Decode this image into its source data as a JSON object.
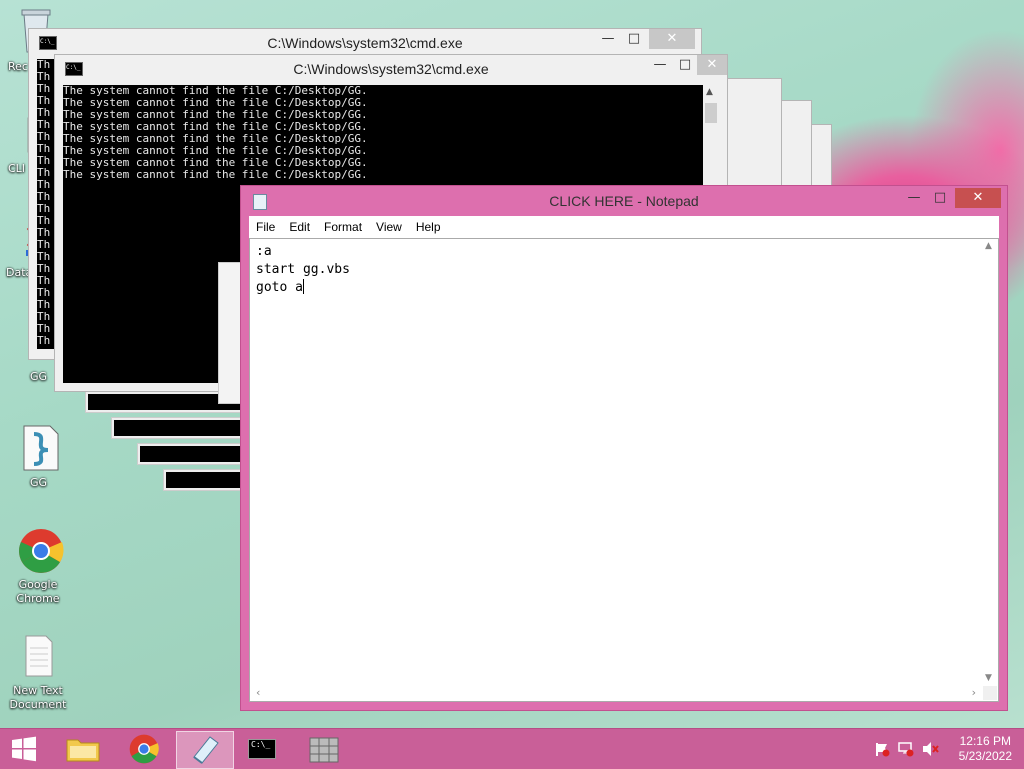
{
  "desktop": {
    "icons": [
      {
        "label": "Rec"
      },
      {
        "label": "CLI"
      },
      {
        "label": "Data"
      },
      {
        "label": "GG"
      },
      {
        "label": "GG"
      },
      {
        "label": "Google Chrome"
      },
      {
        "label": "New Text Document"
      }
    ]
  },
  "cmd_windows": {
    "title": "C:\\Windows\\system32\\cmd.exe",
    "icon_text": "C:\\_",
    "error_line": "The system cannot find the file C:/Desktop/GG.",
    "truncated_prefix": "Th"
  },
  "notepad": {
    "title": "CLICK HERE - Notepad",
    "menu": [
      "File",
      "Edit",
      "Format",
      "View",
      "Help"
    ],
    "lines": [
      ":a",
      "start gg.vbs",
      "goto a"
    ]
  },
  "taskbar": {
    "time": "12:16 PM",
    "date": "5/23/2022"
  },
  "colors": {
    "accent": "#dd6fae",
    "taskbar": "#c95f98",
    "console_bg": "#000000"
  }
}
